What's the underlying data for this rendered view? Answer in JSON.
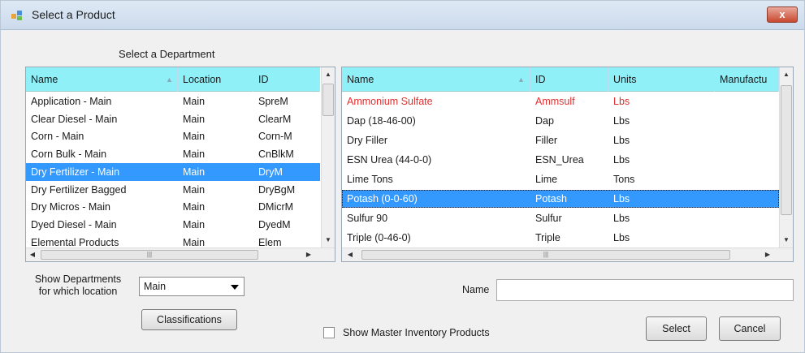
{
  "window": {
    "title": "Select a Product",
    "close_glyph": "x"
  },
  "departments": {
    "caption": "Select a Department",
    "columns": [
      "Name",
      "Location",
      "ID"
    ],
    "rows": [
      {
        "name": "Application - Main",
        "location": "Main",
        "id": "SpreM"
      },
      {
        "name": "Clear Diesel - Main",
        "location": "Main",
        "id": "ClearM"
      },
      {
        "name": "Corn - Main",
        "location": "Main",
        "id": "Corn-M"
      },
      {
        "name": "Corn Bulk - Main",
        "location": "Main",
        "id": "CnBlkM"
      },
      {
        "name": "Dry Fertilizer - Main",
        "location": "Main",
        "id": "DryM"
      },
      {
        "name": "Dry Fertilizer Bagged",
        "location": "Main",
        "id": "DryBgM"
      },
      {
        "name": "Dry Micros - Main",
        "location": "Main",
        "id": "DMicrM"
      },
      {
        "name": "Dyed Diesel - Main",
        "location": "Main",
        "id": "DyedM"
      },
      {
        "name": "Elemental Products",
        "location": "Main",
        "id": "Elem"
      }
    ],
    "selected_index": 4
  },
  "products": {
    "columns": [
      "Name",
      "ID",
      "Units",
      "Manufactu"
    ],
    "rows": [
      {
        "name": "Ammonium Sulfate",
        "id": "Ammsulf",
        "units": "Lbs",
        "mfr": ""
      },
      {
        "name": "Dap (18-46-00)",
        "id": "Dap",
        "units": "Lbs",
        "mfr": ""
      },
      {
        "name": "Dry Filler",
        "id": "Filler",
        "units": "Lbs",
        "mfr": ""
      },
      {
        "name": "ESN Urea (44-0-0)",
        "id": "ESN_Urea",
        "units": "Lbs",
        "mfr": ""
      },
      {
        "name": "Lime Tons",
        "id": "Lime",
        "units": "Tons",
        "mfr": ""
      },
      {
        "name": "Potash (0-0-60)",
        "id": "Potash",
        "units": "Lbs",
        "mfr": ""
      },
      {
        "name": "Sulfur 90",
        "id": "Sulfur",
        "units": "Lbs",
        "mfr": ""
      },
      {
        "name": "Triple (0-46-0)",
        "id": "Triple",
        "units": "Lbs",
        "mfr": ""
      }
    ],
    "selected_index": 5,
    "red_index": 0
  },
  "controls": {
    "show_departments_label": "Show Departments\nfor which location",
    "location_value": "Main",
    "classifications_label": "Classifications",
    "name_label": "Name",
    "name_value": "",
    "master_inventory_label": "Show Master Inventory Products",
    "master_inventory_checked": false,
    "select_label": "Select",
    "cancel_label": "Cancel"
  },
  "icons": {
    "app": "product-select-icon",
    "close": "close-icon",
    "sort": "sort-ascending-icon",
    "scroll_up": "scroll-up-icon",
    "scroll_down": "scroll-down-icon",
    "scroll_left": "scroll-left-icon",
    "scroll_right": "scroll-right-icon",
    "dropdown": "chevron-down-icon"
  },
  "colors": {
    "header_bg": "#8ff0f8",
    "selection": "#3399ff",
    "highlight_text": "#e03030"
  }
}
